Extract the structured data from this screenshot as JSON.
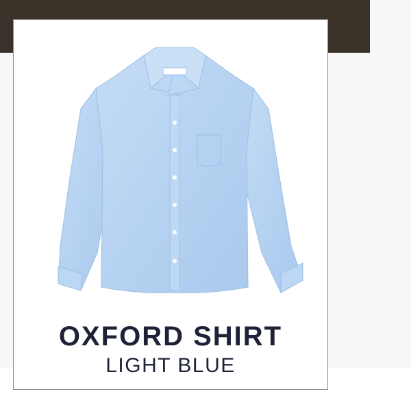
{
  "product": {
    "name": "OXFORD SHIRT",
    "color": "LIGHT BLUE",
    "image_icon": "shirt-image"
  },
  "colors": {
    "dark_band": "#3a3128",
    "panel_bg": "#f7f7f7",
    "shirt_blue": "#b6d3f2",
    "title_text": "#1e2236"
  }
}
